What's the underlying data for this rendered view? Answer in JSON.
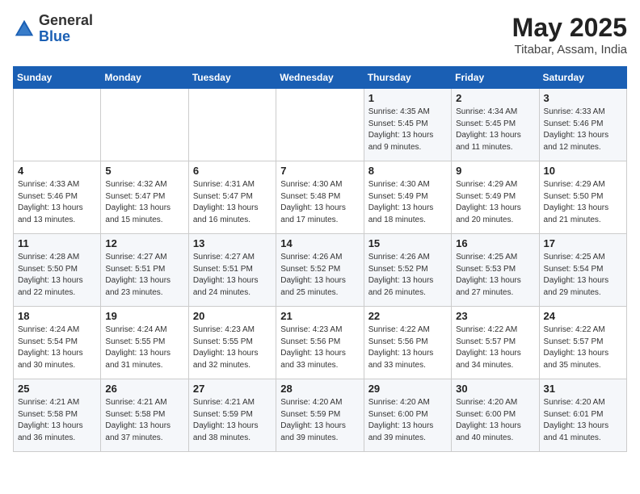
{
  "header": {
    "logo_general": "General",
    "logo_blue": "Blue",
    "month_year": "May 2025",
    "location": "Titabar, Assam, India"
  },
  "days_of_week": [
    "Sunday",
    "Monday",
    "Tuesday",
    "Wednesday",
    "Thursday",
    "Friday",
    "Saturday"
  ],
  "weeks": [
    [
      {
        "day": "",
        "info": ""
      },
      {
        "day": "",
        "info": ""
      },
      {
        "day": "",
        "info": ""
      },
      {
        "day": "",
        "info": ""
      },
      {
        "day": "1",
        "info": "Sunrise: 4:35 AM\nSunset: 5:45 PM\nDaylight: 13 hours\nand 9 minutes."
      },
      {
        "day": "2",
        "info": "Sunrise: 4:34 AM\nSunset: 5:45 PM\nDaylight: 13 hours\nand 11 minutes."
      },
      {
        "day": "3",
        "info": "Sunrise: 4:33 AM\nSunset: 5:46 PM\nDaylight: 13 hours\nand 12 minutes."
      }
    ],
    [
      {
        "day": "4",
        "info": "Sunrise: 4:33 AM\nSunset: 5:46 PM\nDaylight: 13 hours\nand 13 minutes."
      },
      {
        "day": "5",
        "info": "Sunrise: 4:32 AM\nSunset: 5:47 PM\nDaylight: 13 hours\nand 15 minutes."
      },
      {
        "day": "6",
        "info": "Sunrise: 4:31 AM\nSunset: 5:47 PM\nDaylight: 13 hours\nand 16 minutes."
      },
      {
        "day": "7",
        "info": "Sunrise: 4:30 AM\nSunset: 5:48 PM\nDaylight: 13 hours\nand 17 minutes."
      },
      {
        "day": "8",
        "info": "Sunrise: 4:30 AM\nSunset: 5:49 PM\nDaylight: 13 hours\nand 18 minutes."
      },
      {
        "day": "9",
        "info": "Sunrise: 4:29 AM\nSunset: 5:49 PM\nDaylight: 13 hours\nand 20 minutes."
      },
      {
        "day": "10",
        "info": "Sunrise: 4:29 AM\nSunset: 5:50 PM\nDaylight: 13 hours\nand 21 minutes."
      }
    ],
    [
      {
        "day": "11",
        "info": "Sunrise: 4:28 AM\nSunset: 5:50 PM\nDaylight: 13 hours\nand 22 minutes."
      },
      {
        "day": "12",
        "info": "Sunrise: 4:27 AM\nSunset: 5:51 PM\nDaylight: 13 hours\nand 23 minutes."
      },
      {
        "day": "13",
        "info": "Sunrise: 4:27 AM\nSunset: 5:51 PM\nDaylight: 13 hours\nand 24 minutes."
      },
      {
        "day": "14",
        "info": "Sunrise: 4:26 AM\nSunset: 5:52 PM\nDaylight: 13 hours\nand 25 minutes."
      },
      {
        "day": "15",
        "info": "Sunrise: 4:26 AM\nSunset: 5:52 PM\nDaylight: 13 hours\nand 26 minutes."
      },
      {
        "day": "16",
        "info": "Sunrise: 4:25 AM\nSunset: 5:53 PM\nDaylight: 13 hours\nand 27 minutes."
      },
      {
        "day": "17",
        "info": "Sunrise: 4:25 AM\nSunset: 5:54 PM\nDaylight: 13 hours\nand 29 minutes."
      }
    ],
    [
      {
        "day": "18",
        "info": "Sunrise: 4:24 AM\nSunset: 5:54 PM\nDaylight: 13 hours\nand 30 minutes."
      },
      {
        "day": "19",
        "info": "Sunrise: 4:24 AM\nSunset: 5:55 PM\nDaylight: 13 hours\nand 31 minutes."
      },
      {
        "day": "20",
        "info": "Sunrise: 4:23 AM\nSunset: 5:55 PM\nDaylight: 13 hours\nand 32 minutes."
      },
      {
        "day": "21",
        "info": "Sunrise: 4:23 AM\nSunset: 5:56 PM\nDaylight: 13 hours\nand 33 minutes."
      },
      {
        "day": "22",
        "info": "Sunrise: 4:22 AM\nSunset: 5:56 PM\nDaylight: 13 hours\nand 33 minutes."
      },
      {
        "day": "23",
        "info": "Sunrise: 4:22 AM\nSunset: 5:57 PM\nDaylight: 13 hours\nand 34 minutes."
      },
      {
        "day": "24",
        "info": "Sunrise: 4:22 AM\nSunset: 5:57 PM\nDaylight: 13 hours\nand 35 minutes."
      }
    ],
    [
      {
        "day": "25",
        "info": "Sunrise: 4:21 AM\nSunset: 5:58 PM\nDaylight: 13 hours\nand 36 minutes."
      },
      {
        "day": "26",
        "info": "Sunrise: 4:21 AM\nSunset: 5:58 PM\nDaylight: 13 hours\nand 37 minutes."
      },
      {
        "day": "27",
        "info": "Sunrise: 4:21 AM\nSunset: 5:59 PM\nDaylight: 13 hours\nand 38 minutes."
      },
      {
        "day": "28",
        "info": "Sunrise: 4:20 AM\nSunset: 5:59 PM\nDaylight: 13 hours\nand 39 minutes."
      },
      {
        "day": "29",
        "info": "Sunrise: 4:20 AM\nSunset: 6:00 PM\nDaylight: 13 hours\nand 39 minutes."
      },
      {
        "day": "30",
        "info": "Sunrise: 4:20 AM\nSunset: 6:00 PM\nDaylight: 13 hours\nand 40 minutes."
      },
      {
        "day": "31",
        "info": "Sunrise: 4:20 AM\nSunset: 6:01 PM\nDaylight: 13 hours\nand 41 minutes."
      }
    ]
  ]
}
